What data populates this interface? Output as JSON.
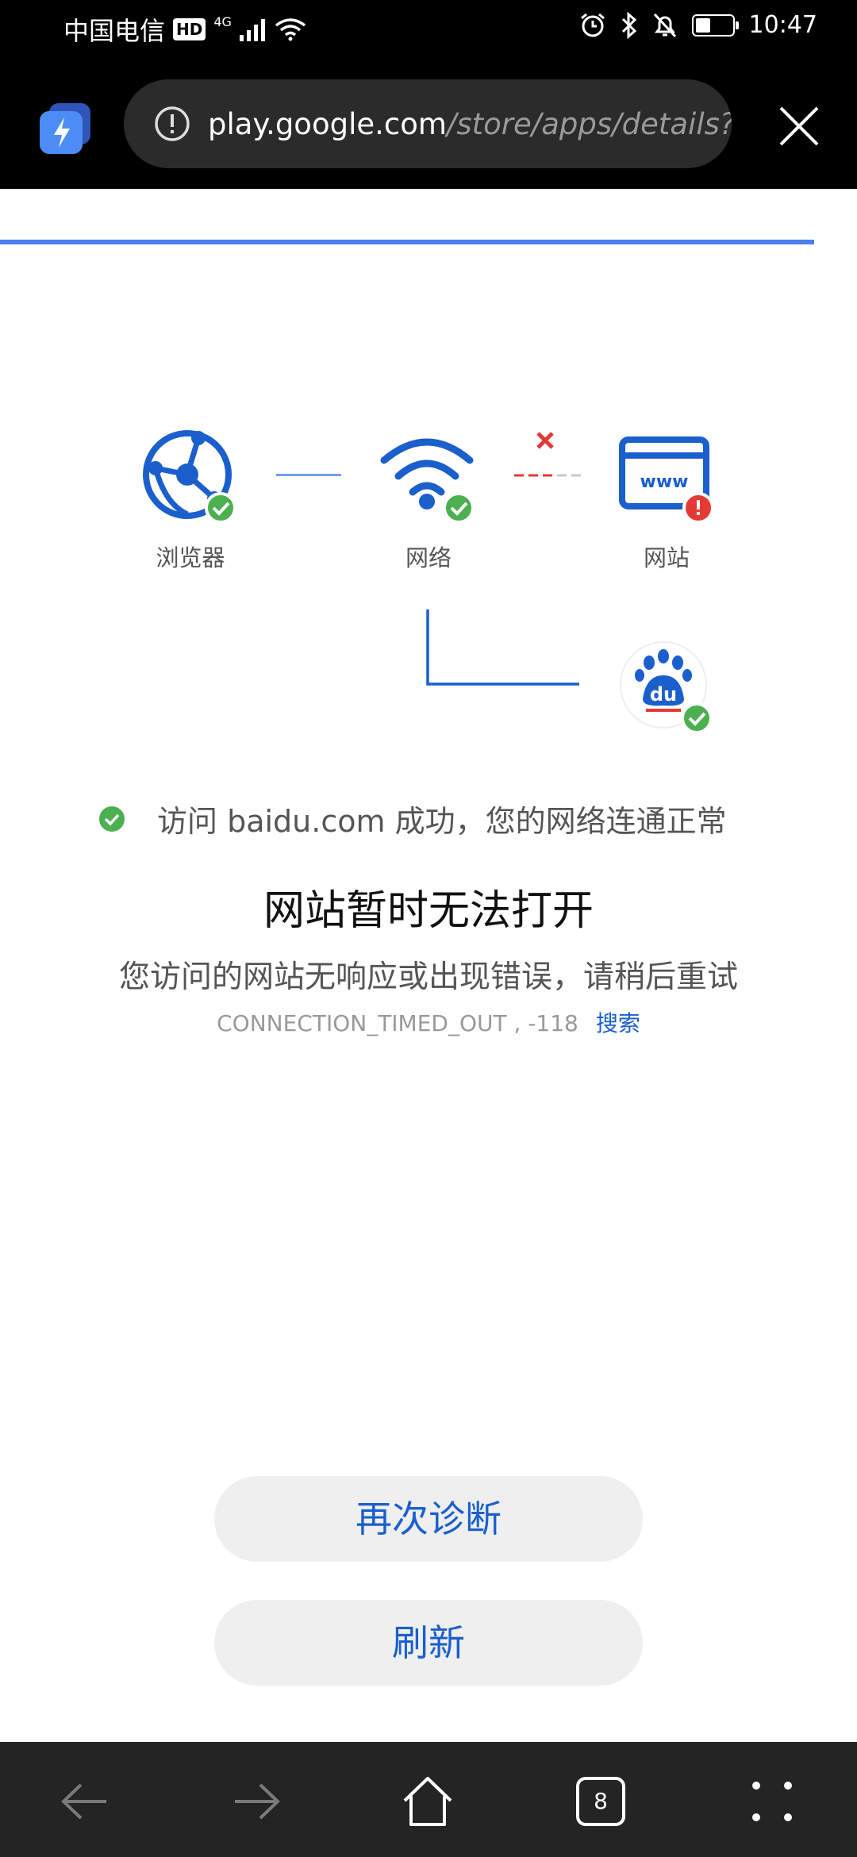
{
  "status_bar": {
    "carrier": "中国电信",
    "hd_label": "HD",
    "network_type": "4G",
    "time": "10:47",
    "battery_level": 0.4,
    "icons": [
      "signal-icon",
      "wifi-icon",
      "alarm-icon",
      "bluetooth-icon",
      "mute-icon",
      "battery-icon"
    ]
  },
  "browser": {
    "url_host": "play.google.com",
    "url_path": "/store/apps/details?id=",
    "page_load_progress": 0.95,
    "icons": [
      "app-bolt-icon",
      "info-icon",
      "close-icon"
    ]
  },
  "diagnosis": {
    "nodes": [
      {
        "label": "浏览器",
        "icon": "globe-icon",
        "status": "ok"
      },
      {
        "label": "网络",
        "icon": "wifi-icon",
        "status": "ok"
      },
      {
        "label": "网站",
        "icon": "www-icon",
        "status": "error"
      }
    ],
    "baidu_node": {
      "icon": "baidu-paw-icon",
      "text": "du",
      "status": "ok"
    },
    "check_message": "访问 baidu.com 成功，您的网络连通正常"
  },
  "error": {
    "title": "网站暂时无法打开",
    "subtitle": "您访问的网站无响应或出现错误，请稍后重试",
    "code": "CONNECTION_TIMED_OUT , -118",
    "search_link": "搜索"
  },
  "actions": {
    "rediagnose_label": "再次诊断",
    "refresh_label": "刷新"
  },
  "bottom_nav": {
    "tab_count": "8",
    "icons": [
      "back-icon",
      "forward-icon",
      "home-icon",
      "tabs-icon",
      "menu-icon"
    ]
  },
  "colors": {
    "accent_blue": "#1a5fcc",
    "success_green": "#4caf50",
    "error_red": "#e53935",
    "progress_blue": "#4a7ff0"
  }
}
